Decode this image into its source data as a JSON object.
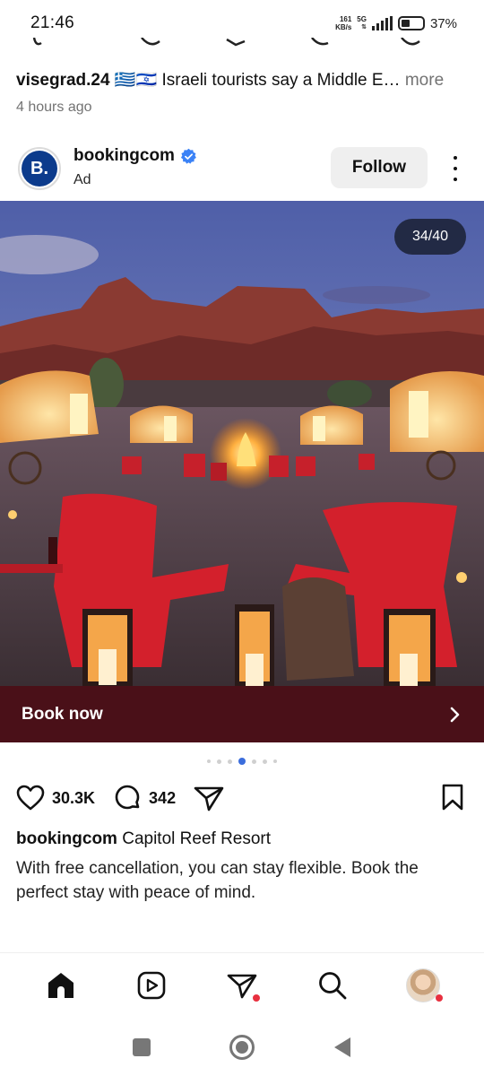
{
  "status_bar": {
    "time": "21:46",
    "net_speed_value": "161",
    "net_speed_unit": "KB/s",
    "network_type": "5G",
    "battery": "37%"
  },
  "previous_post": {
    "username": "visegrad.24",
    "flags": "🇬🇷🇮🇱",
    "caption": "Israeli tourists say a Middle E…",
    "more": "more",
    "time_ago": "4 hours ago"
  },
  "post": {
    "author": "bookingcom",
    "avatar_letter": "B.",
    "ad_label": "Ad",
    "follow_label": "Follow",
    "image_counter": "34/40",
    "cta_label": "Book now",
    "likes": "30.3K",
    "comments": "342",
    "caption_user": "bookingcom",
    "caption_title": "Capitol Reef Resort",
    "caption_body": "With free cancellation, you can stay flexible. Book the perfect stay with peace of mind."
  },
  "icons": {
    "verified": "verified-badge-icon",
    "more": "more-options-icon",
    "like": "heart-icon",
    "comment": "comment-icon",
    "share": "send-icon",
    "save": "bookmark-icon",
    "nav_home": "home-icon",
    "nav_reels": "reels-icon",
    "nav_messages": "direct-message-icon",
    "nav_search": "search-icon",
    "nav_profile": "profile-avatar"
  },
  "colors": {
    "cta_background": "#4a1018",
    "verified_blue": "#3b82f6",
    "active_dot": "#3b6ddc",
    "notification_dot": "#e8303f",
    "brand_blue": "#0c3b8c"
  }
}
